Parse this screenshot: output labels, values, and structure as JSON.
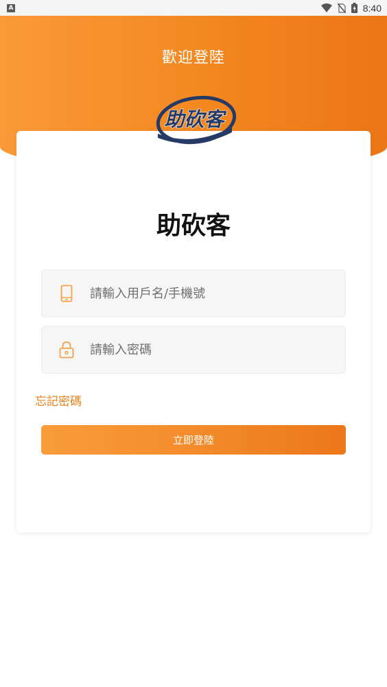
{
  "status_bar": {
    "left_icon_letter": "A",
    "time": "8:40",
    "icons": [
      "wifi-icon",
      "no-sim-icon",
      "battery-icon"
    ]
  },
  "header": {
    "title": "歡迎登陸"
  },
  "logo": {
    "text": "助砍客"
  },
  "app_name": "助砍客",
  "form": {
    "username_placeholder": "請輸入用戶名/手機號",
    "username_value": "",
    "password_placeholder": "請輸入密碼",
    "password_value": "",
    "forgot_label": "忘記密碼",
    "login_label": "立即登陸"
  },
  "colors": {
    "accent": "#f28a2a",
    "accent_light": "#fa9c3c",
    "accent_dark": "#ec7719",
    "logo_navy": "#263a66"
  }
}
